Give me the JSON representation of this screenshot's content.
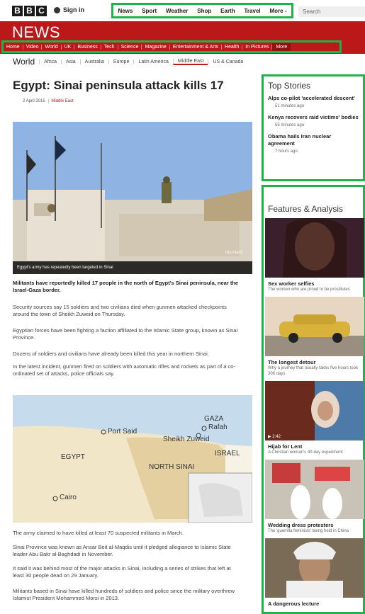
{
  "global_nav": {
    "logo_letters": [
      "B",
      "B",
      "C"
    ],
    "sign_in": "Sign in",
    "links": [
      "News",
      "Sport",
      "Weather",
      "Shop",
      "Earth",
      "Travel",
      "More -"
    ],
    "search_placeholder": "Search"
  },
  "news_bar": {
    "title": "NEWS",
    "sections": [
      "Home",
      "Video",
      "World",
      "UK",
      "Business",
      "Tech",
      "Science",
      "Magazine",
      "Entertainment & Arts",
      "Health",
      "In Pictures",
      "More"
    ]
  },
  "sub_nav": {
    "current": "World",
    "items": [
      "Africa",
      "Asia",
      "Australia",
      "Europe",
      "Latin America",
      "Middle East",
      "US & Canada"
    ]
  },
  "article": {
    "headline": "Egypt: Sinai peninsula attack kills 17",
    "date": "2 April 2015",
    "section": "Middle East",
    "image_caption": "Egypt's army has repeatedly been targeted in Sinai",
    "image_credit": "REUTERS",
    "paragraphs": [
      "Militants have reportedly killed 17 people in the north of Egypt's Sinai peninsula, near the Israel-Gaza border.",
      "Security sources say 15 soldiers and two civilians died when gunmen attacked checkpoints around the town of Sheikh Zuweid on Thursday.",
      "Egyptian forces have been fighting a faction affiliated to the Islamic State group, known as Sinai Province.",
      "Dozens of soldiers and civilians have already been killed this year in northern Sinai.",
      "In the latest incident, gunmen fired on soldiers with automatic rifles and rockets as part of a co-ordinated set of attacks, police officials say.",
      "The army claimed to have killed at least 70 suspected militants in March.",
      "Sinai Province was known as Ansar Beit al-Maqdis until it pledged allegiance to Islamic State leader Abu Bakr al-Baghdadi in November.",
      "It said it was behind most of the major attacks in Sinai, including a series of strikes that left at least 30 people dead on 29 January.",
      "Militants based in Sinai have killed hundreds of soldiers and police since the military overthrew Islamist President Mohammed Morsi in 2013."
    ],
    "map_labels": {
      "gaza": "GAZA",
      "rafah": "Rafah",
      "port_said": "Port Said",
      "sheikh_zuweid": "Sheikh Zuweid",
      "egypt": "EGYPT",
      "israel": "ISRAEL",
      "north_sinai": "NORTH SINAI",
      "cairo": "Cairo"
    }
  },
  "top_stories": {
    "title": "Top Stories",
    "items": [
      {
        "title": "Alps co-pilot 'accelerated descent'",
        "time": "51 minutes ago"
      },
      {
        "title": "Kenya recovers raid victims' bodies",
        "time": "55 minutes ago"
      },
      {
        "title": "Obama hails Iran nuclear agreement",
        "time": "7 hours ago"
      }
    ]
  },
  "features": {
    "title": "Features & Analysis",
    "items": [
      {
        "title": "Sex worker selfies",
        "subtitle": "The women who are proud to be prostitutes"
      },
      {
        "title": "The longest detour",
        "subtitle": "Why a journey that usually takes five hours took 306 days"
      },
      {
        "title": "Hijab for Lent",
        "subtitle": "A Christian woman's 40-day experiment",
        "video_duration": "2:42"
      },
      {
        "title": "Wedding dress protesters",
        "subtitle": "The 'guerrilla feminists' being held in China"
      },
      {
        "title": "A dangerous lecture",
        "subtitle": ""
      }
    ]
  },
  "colors": {
    "brand_red": "#bb1919",
    "highlight_green": "#1fb34a"
  }
}
